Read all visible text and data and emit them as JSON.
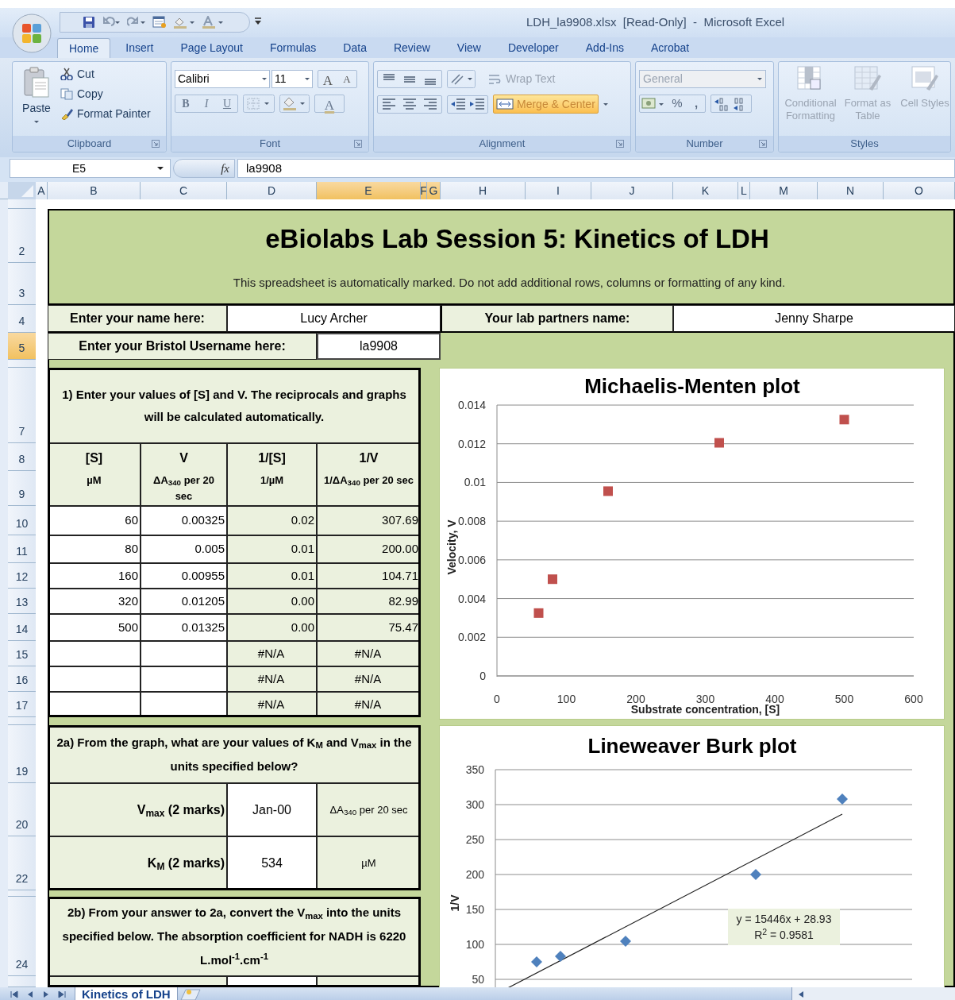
{
  "window": {
    "title": "LDH_la9908.xlsx  [Read-Only]  -  Microsoft Excel"
  },
  "ribbon_tabs": [
    {
      "label": "Home",
      "selected": true
    },
    {
      "label": "Insert",
      "selected": false
    },
    {
      "label": "Page Layout",
      "selected": false
    },
    {
      "label": "Formulas",
      "selected": false
    },
    {
      "label": "Data",
      "selected": false
    },
    {
      "label": "Review",
      "selected": false
    },
    {
      "label": "View",
      "selected": false
    },
    {
      "label": "Developer",
      "selected": false
    },
    {
      "label": "Add-Ins",
      "selected": false
    },
    {
      "label": "Acrobat",
      "selected": false
    }
  ],
  "clipboard": {
    "label": "Clipboard",
    "paste": "Paste",
    "cut": "Cut",
    "copy": "Copy",
    "format_painter": "Format Painter"
  },
  "font": {
    "label": "Font",
    "name": "Calibri",
    "size": "11",
    "grow": "A",
    "shrink": "A",
    "style_buttons": [
      "B",
      "I",
      "U"
    ],
    "color_button": "A"
  },
  "alignment": {
    "label": "Alignment",
    "wrap_text": {
      "label": "Wrap Text",
      "disabled": true
    },
    "merge_center": {
      "label": "Merge & Center",
      "highlighted": true
    }
  },
  "number": {
    "label": "Number",
    "format": {
      "value": "General",
      "disabled": true
    },
    "percent": "%",
    "comma": ","
  },
  "styles": {
    "label": "Styles",
    "buttons": [
      {
        "label": "Conditional Formatting",
        "disabled": true
      },
      {
        "label": "Format as Table",
        "disabled": true
      },
      {
        "label": "Cell Styles",
        "disabled": true
      }
    ]
  },
  "formula_bar": {
    "name_box": "E5",
    "function_label": "fx",
    "formula": "la9908"
  },
  "columns": [
    {
      "label": "A",
      "selected": false
    },
    {
      "label": "B",
      "selected": false
    },
    {
      "label": "C",
      "selected": false
    },
    {
      "label": "D",
      "selected": false
    },
    {
      "label": "E",
      "selected": true
    },
    {
      "label": "F",
      "selected": true
    },
    {
      "label": "G",
      "selected": true
    },
    {
      "label": "H",
      "selected": false
    },
    {
      "label": "I",
      "selected": false
    },
    {
      "label": "J",
      "selected": false
    },
    {
      "label": "K",
      "selected": false
    },
    {
      "label": "L",
      "selected": false
    },
    {
      "label": "M",
      "selected": false
    },
    {
      "label": "N",
      "selected": false
    },
    {
      "label": "O",
      "selected": false
    }
  ],
  "row_headers": [
    {
      "label": "2",
      "selected": false
    },
    {
      "label": "3",
      "selected": false
    },
    {
      "label": "4",
      "selected": false
    },
    {
      "label": "5",
      "selected": true
    },
    {
      "label": "7",
      "selected": false
    },
    {
      "label": "8",
      "selected": false
    },
    {
      "label": "9",
      "selected": false
    },
    {
      "label": "10",
      "selected": false
    },
    {
      "label": "11",
      "selected": false
    },
    {
      "label": "12",
      "selected": false
    },
    {
      "label": "13",
      "selected": false
    },
    {
      "label": "14",
      "selected": false
    },
    {
      "label": "15",
      "selected": false
    },
    {
      "label": "16",
      "selected": false
    },
    {
      "label": "17",
      "selected": false
    },
    {
      "label": "19",
      "selected": false
    },
    {
      "label": "20",
      "selected": false
    },
    {
      "label": "22",
      "selected": false
    },
    {
      "label": "24",
      "selected": false
    }
  ],
  "sheet": {
    "title": "eBiolabs Lab Session 5: Kinetics of LDH",
    "notice": "This spreadsheet is automatically marked.  Do not add additional rows, columns or formatting of any kind.",
    "name_label": "Enter your name here:",
    "name_value": "Lucy Archer",
    "partner_label": "Your lab partners name:",
    "partner_value": "Jenny Sharpe",
    "username_label": "Enter your Bristol Username here:",
    "username_value": "la9908",
    "question_1": "1)  Enter your values of [S] and V.  The reciprocals and graphs will be calculated automatically.",
    "table_headers": [
      {
        "label": "[S]",
        "unit": "µM"
      },
      {
        "label": "V",
        "unit": "ΔA$_{340}$ per 20 sec"
      },
      {
        "label": "1/[S]",
        "unit": "1/µM"
      },
      {
        "label": "1/V",
        "unit": "1/ΔA$_{340}$ per 20 sec"
      }
    ],
    "table_rows": [
      {
        "s": "60",
        "v": "0.00325",
        "inv_s": "0.02",
        "inv_v": "307.69"
      },
      {
        "s": "80",
        "v": "0.005",
        "inv_s": "0.01",
        "inv_v": "200.00"
      },
      {
        "s": "160",
        "v": "0.00955",
        "inv_s": "0.01",
        "inv_v": "104.71"
      },
      {
        "s": "320",
        "v": "0.01205",
        "inv_s": "0.00",
        "inv_v": "82.99"
      },
      {
        "s": "500",
        "v": "0.01325",
        "inv_s": "0.00",
        "inv_v": "75.47"
      },
      {
        "inv_s": "#N/A",
        "inv_v": "#N/A"
      },
      {
        "inv_s": "#N/A",
        "inv_v": "#N/A"
      },
      {
        "inv_s": "#N/A",
        "inv_v": "#N/A"
      }
    ],
    "question_2a": "2a)  From the graph, what are your values of K$_{M}$ and V$_{max}$ in the units specified below?",
    "answers": [
      {
        "label": "V$_{max}$ (2 marks)",
        "value": "Jan-00",
        "unit": "ΔA$_{340}$ per 20 sec"
      },
      {
        "label": "K$_{M}$ (2 marks)",
        "value": "534",
        "unit": "µM"
      }
    ],
    "question_2b": "2b)  From your answer to 2a, convert the V$_{max}$ into the units specified below.  The absorption coefficient for NADH is 6220 L.mol$^{-1}$.cm$^{-1}$"
  },
  "charts": [
    {
      "chart_data": {
        "type": "scatter",
        "title": "Michaelis-Menten plot",
        "xlabel": "Substrate concentration,  [S]",
        "ylabel": "Velocity, V",
        "xlim": [
          0,
          600
        ],
        "ylim": [
          0,
          0.014
        ],
        "xticks": [
          0,
          100,
          200,
          300,
          400,
          500,
          600
        ],
        "yticks": [
          0,
          0.002,
          0.004,
          0.006,
          0.008,
          {
            "value": 0.01,
            "label": "0.01"
          },
          0.012,
          0.014
        ],
        "grid": true,
        "series": [
          {
            "color": "#c0504d",
            "x": [
              60,
              80,
              160,
              320,
              500
            ],
            "values": [
              0.00325,
              0.005,
              0.00955,
              0.01205,
              0.01325
            ]
          }
        ]
      }
    },
    {
      "title": "Lineweaver Burk plot",
      "ylabel": "1/V",
      "y_axis_labels": [
        "350",
        "300",
        "250",
        "200",
        "150",
        "100",
        "50"
      ],
      "trendline_label": [
        "y = 15446x + 28.93",
        "R$^{2}$ = 0.9581"
      ]
    }
  ],
  "sheet_tabs": [
    {
      "label": "Kinetics of LDH",
      "selected": true
    }
  ]
}
